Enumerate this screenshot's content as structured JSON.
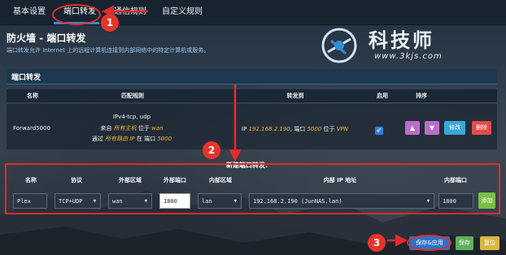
{
  "tabs": [
    "基本设置",
    "端口转发",
    "通信规则",
    "自定义规则"
  ],
  "page": {
    "title": "防火墙 - 端口转发",
    "description": "端口转发允许 Internet 上的远程计算机连接到内部网络中的特定计算机或服务。"
  },
  "watermark": {
    "name": "科技师",
    "url": "www.3kjs.com"
  },
  "section": {
    "title": "端口转发",
    "headers": [
      "名称",
      "匹配规则",
      "转发到",
      "启用",
      "排序"
    ]
  },
  "rule": {
    "name": "Forward5000",
    "proto": "IPv4-tcp, udp",
    "line2_pre": "来自",
    "line2_italic": "所有主机",
    "line2_mid": "位于",
    "line2_zone": "wan",
    "line3_pre": "通过",
    "line3_italic": "所有路由 IP",
    "line3_mid": "在 端口",
    "line3_port": "5000",
    "fwd_pre": "IP",
    "fwd_ip": "192.168.2.190",
    "fwd_mid": ", 端口",
    "fwd_port": "5000",
    "fwd_mid2": "位于",
    "fwd_zone": "VPN",
    "enabled": "✔",
    "up": "▲",
    "down": "▼",
    "edit": "修改",
    "delete": "删除"
  },
  "new_rule": {
    "title": "新建端口转发:",
    "headers": [
      "名称",
      "协议",
      "外部区域",
      "外部端口",
      "内部区域",
      "内部 IP 地址",
      "内部端口"
    ],
    "name_value": "Plex",
    "protocol_value": "TCP+UDP",
    "ext_zone_value": "wan",
    "ext_port_value": "1800",
    "int_zone_value": "lan",
    "int_ip_value": "192.168.2.190 (JunNAS.lan)",
    "int_port_value": "1800",
    "add_label": "添加"
  },
  "actions": {
    "save_apply": "保存&应用",
    "save": "保存",
    "reset": "复位"
  },
  "annotations": [
    "1",
    "2",
    "3"
  ],
  "colors": {
    "accent": "#2e8fd6",
    "highlight": "#e52a2a",
    "italic": "#f2b134"
  }
}
